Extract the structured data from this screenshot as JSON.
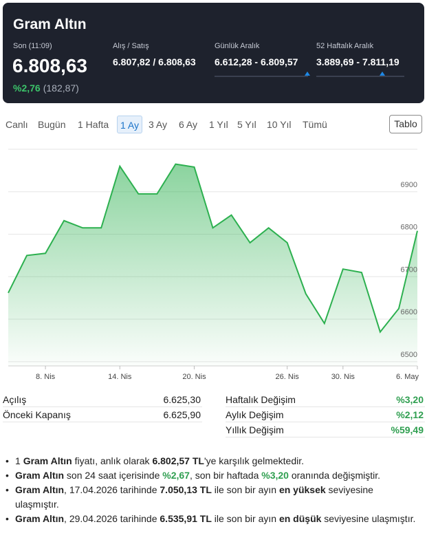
{
  "header": {
    "title": "Gram Altın",
    "son_label": "Son (11:09)",
    "son_value": "6.808,63",
    "change_pct": "%2,76",
    "change_abs": "(182,87)",
    "alis_satis_label": "Alış / Satış",
    "alis_satis_value": "6.807,82 / 6.808,63",
    "gunluk_label": "Günlük Aralık",
    "gunluk_value": "6.612,28 - 6.809,57",
    "hafta52_label": "52 Haftalık Aralık",
    "hafta52_value": "3.889,69 - 7.811,19",
    "gunluk_marker_fraction": 0.99,
    "hafta52_marker_fraction": 0.75
  },
  "tabs": [
    "Canlı",
    "Bugün",
    "1 Hafta",
    "1 Ay",
    "3 Ay",
    "6 Ay",
    "1 Yıl",
    "5 Yıl",
    "10 Yıl",
    "Tümü"
  ],
  "active_tab": "1 Ay",
  "tablo_button": "Tablo",
  "chart_data": {
    "type": "area",
    "x": [
      "2026-04-06",
      "2026-04-07",
      "2026-04-08",
      "2026-04-09",
      "2026-04-10",
      "2026-04-13",
      "2026-04-14",
      "2026-04-15",
      "2026-04-16",
      "2026-04-17",
      "2026-04-20",
      "2026-04-21",
      "2026-04-22",
      "2026-04-23",
      "2026-04-24",
      "2026-04-27",
      "2026-04-28",
      "2026-04-29",
      "2026-04-30",
      "2026-05-01",
      "2026-05-04",
      "2026-05-05",
      "2026-05-06"
    ],
    "values": [
      6662,
      6750,
      6755,
      6832,
      6815,
      6815,
      6960,
      6895,
      6895,
      6965,
      6958,
      6815,
      6845,
      6780,
      6815,
      6780,
      6660,
      6590,
      6718,
      6710,
      6570,
      6625,
      6808
    ],
    "xtick_labels": [
      "8. Nis",
      "14. Nis",
      "20. Nis",
      "26. Nis",
      "30. Nis",
      "6. May"
    ],
    "xtick_positions": [
      2,
      6,
      10,
      15,
      18,
      22
    ],
    "ytick_labels": [
      "6900",
      "6800",
      "6700",
      "6600",
      "6500"
    ],
    "ytick_values": [
      6900,
      6800,
      6700,
      6600,
      6500
    ],
    "ylim": [
      6490,
      7000
    ],
    "line_color": "#2cb04f",
    "fill_color": "#2cb04f",
    "grid": true
  },
  "stats_left": [
    {
      "label": "Açılış",
      "value": "6.625,30"
    },
    {
      "label": "Önceki Kapanış",
      "value": "6.625,90"
    }
  ],
  "stats_right": [
    {
      "label": "Haftalık Değişim",
      "value": "%3,20"
    },
    {
      "label": "Aylık Değişim",
      "value": "%2,12"
    },
    {
      "label": "Yıllık Değişim",
      "value": "%59,49"
    }
  ],
  "bullets": {
    "b1": {
      "p1": "1 ",
      "bold1": "Gram Altın",
      "p2": " fiyatı, anlık olarak ",
      "bold2": "6.802,57 TL",
      "p3": "'ye karşılık gelmektedir."
    },
    "b2": {
      "bold1": "Gram Altın",
      "p1": " son 24 saat içerisinde ",
      "g1": "%2,67",
      "p2": ", son bir haftada ",
      "g2": "%3,20",
      "p3": " oranında değişmiştir."
    },
    "b3": {
      "bold1": "Gram Altın",
      "p1": ", 17.04.2026 tarihinde ",
      "bold2": "7.050,13 TL",
      "p2": " ile son bir ayın ",
      "bold3": "en yüksek",
      "p3": " seviyesine ulaşmıştır."
    },
    "b4": {
      "bold1": "Gram Altın",
      "p1": ", 29.04.2026 tarihinde ",
      "bold2": "6.535,91 TL",
      "p2": " ile son bir ayın ",
      "bold3": "en düşük",
      "p3": " seviyesine ulaşmıştır."
    }
  }
}
